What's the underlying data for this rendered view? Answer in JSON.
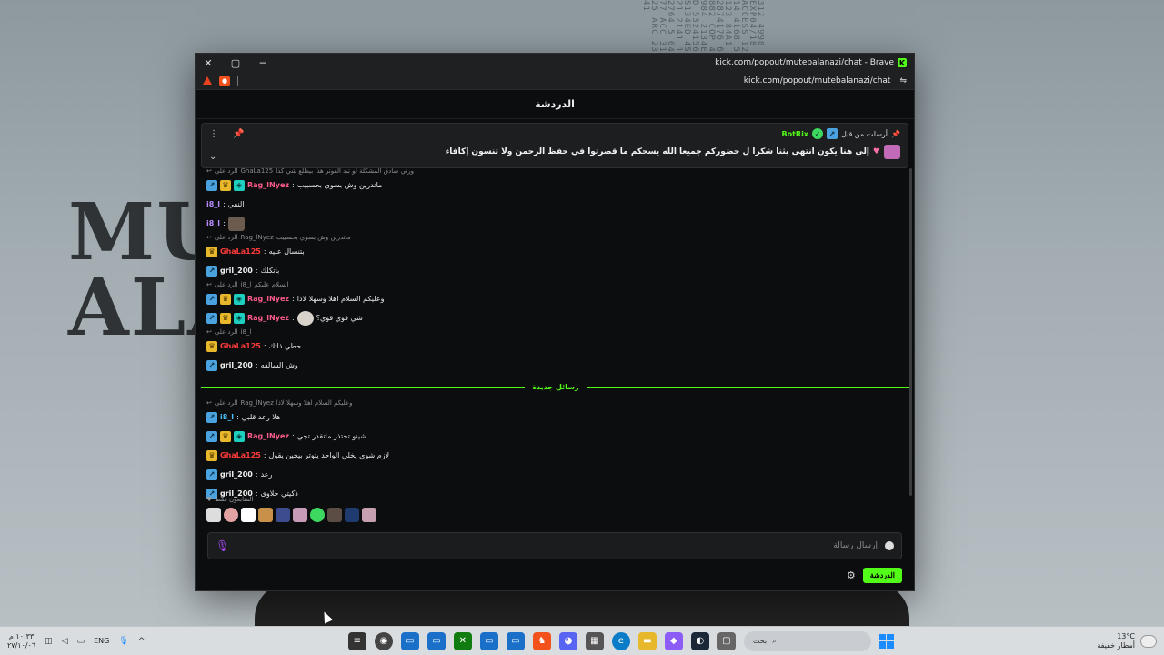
{
  "window": {
    "title": "kick.com/popout/mutebalanazi/chat - Brave",
    "url": "kick.com/popout/mutebalanazi/chat",
    "controls": {
      "close": "✕",
      "maximize": "▢",
      "minimize": "─"
    }
  },
  "wallpaper": {
    "line1": "MU",
    "line2": "ALA",
    "code_text": "312 4998 EXP04/18 ACCESS 1214 4168 5123 84A1 2874176 6882 COP 4984 2134ED 5324156 5134ED 4521 2141 12764 5 64 77 ACC 3125 ARC 2341"
  },
  "chat": {
    "header_title": "الدردشة",
    "pinned": {
      "sent_by_label": "أرسلت من قبل",
      "username": "BotRix",
      "message": "إلى هنا يكون انتهى بثنا شكرا ل حضوركم جميعا الله يسحكم ما قصرتوا في حفظ الرحمن ولا تنسون إكافاء"
    },
    "reply_prefix": "الرد على",
    "messages": [
      {
        "type": "reply",
        "to": "GhaLa125",
        "text": "ورني صادق المشكلة لو تبد الفوتر هذا بيطلع شي كذا"
      },
      {
        "type": "msg",
        "badges": [
          "blue",
          "gold",
          "teal"
        ],
        "user": "Rag_lNyez",
        "color": "pink",
        "text": "ماتدرين وش بسوي بحسبيب"
      },
      {
        "type": "msg",
        "badges": [],
        "user": "i8_l",
        "color": "purple",
        "text": "النفي"
      },
      {
        "type": "msg",
        "badges": [],
        "user": "i8_l",
        "color": "purple",
        "text": "",
        "emote": true
      },
      {
        "type": "reply",
        "to": "Rag_lNyez",
        "text": "ماتدرين وش بسوي بحسبيب"
      },
      {
        "type": "msg",
        "badges": [
          "gold"
        ],
        "user": "GhaLa125",
        "color": "red",
        "text": "بتنسال عليه"
      },
      {
        "type": "msg",
        "badges": [
          "blue"
        ],
        "user": "gril_200",
        "color": "white",
        "text": "باتكلك"
      },
      {
        "type": "reply",
        "to": "i8_l",
        "text": "السلام عليكم"
      },
      {
        "type": "msg",
        "badges": [
          "blue",
          "gold",
          "teal"
        ],
        "user": "Rag_lNyez",
        "color": "pink",
        "text": "وعليكم السلام اهلا وسهلا لاذا"
      },
      {
        "type": "msg",
        "badges": [
          "blue",
          "gold",
          "teal"
        ],
        "user": "Rag_lNyez",
        "color": "pink",
        "text": "شي قوي قوي؟",
        "emote": true
      },
      {
        "type": "reply",
        "to": "i8_l",
        "text": ""
      },
      {
        "type": "msg",
        "badges": [
          "gold"
        ],
        "user": "GhaLa125",
        "color": "red",
        "text": "حطي ذاتك"
      },
      {
        "type": "msg",
        "badges": [
          "blue"
        ],
        "user": "gril_200",
        "color": "white",
        "text": "وش السالفه"
      }
    ],
    "new_messages_label": "رسائل جديدة",
    "new_messages": [
      {
        "type": "reply",
        "to": "Rag_lNyez",
        "text": "وعليكم السلام اهلا وسهلا لاذا"
      },
      {
        "type": "msg",
        "badges": [
          "blue"
        ],
        "user": "i8_l",
        "color": "cyan",
        "text": "هلا رعد قلبي"
      },
      {
        "type": "msg",
        "badges": [
          "blue",
          "gold",
          "teal"
        ],
        "user": "Rag_lNyez",
        "color": "pink",
        "text": "شينو تحتذر ماتقدر تجي"
      },
      {
        "type": "msg",
        "badges": [
          "gold"
        ],
        "user": "GhaLa125",
        "color": "red",
        "text": "لازم شوي يخلي الواحد يتوتر بيجين يقول"
      },
      {
        "type": "msg",
        "badges": [
          "blue"
        ],
        "user": "gril_200",
        "color": "white",
        "text": "رعد"
      },
      {
        "type": "msg",
        "badges": [
          "blue"
        ],
        "user": "gril_200",
        "color": "white",
        "text": "ذكيتي حلاوى"
      }
    ],
    "supporters_label": "المتابعون فقط",
    "input_placeholder": "إرسال رسالة",
    "chat_button": "الدردشة"
  },
  "taskbar": {
    "time": "١٠:٣٣ م",
    "date": "٢٧/١٠/٠٦",
    "language": "ENG",
    "search_placeholder": "بحث",
    "weather_temp": "13°C",
    "weather_desc": "أمطار خفيفة"
  },
  "colors": {
    "kick_green": "#53fc18",
    "windows_blue": "#1a8cff"
  }
}
